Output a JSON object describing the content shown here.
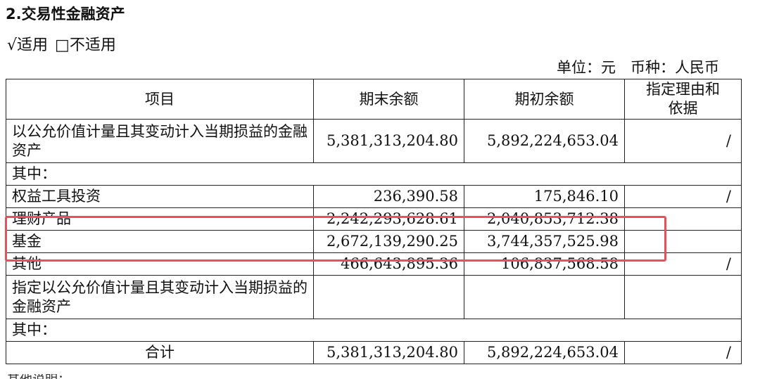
{
  "title": "2.交易性金融资产",
  "applicability": {
    "applicable": "√适用",
    "not_applicable": "□不适用"
  },
  "unit_line": "单位：元　币种：人民币",
  "table": {
    "headers": [
      "项目",
      "期末余额",
      "期初余额",
      "指定理由和依据"
    ],
    "rows": [
      {
        "item": "以公允价值计量且其变动计入当期损益的金融资产",
        "end": "5,381,313,204.80",
        "begin": "5,892,224,653.04",
        "reason": "/"
      },
      {
        "item": "其中：",
        "end": "",
        "begin": "",
        "reason": ""
      },
      {
        "item": "权益工具投资",
        "end": "236,390.58",
        "begin": "175,846.10",
        "reason": "/"
      },
      {
        "item": "理财产品",
        "end": "2,242,293,628.61",
        "begin": "2,040,853,712.38",
        "reason": ""
      },
      {
        "item": "基金",
        "end": "2,672,139,290.25",
        "begin": "3,744,357,525.98",
        "reason": ""
      },
      {
        "item": "其他",
        "end": "466,643,895.36",
        "begin": "106,837,568.58",
        "reason": "/"
      },
      {
        "item": "指定以公允价值计量且其变动计入当期损益的金融资产",
        "end": "",
        "begin": "",
        "reason": ""
      },
      {
        "item": "其中：",
        "end": "",
        "begin": "",
        "reason": ""
      },
      {
        "item": "合计",
        "end": "5,381,313,204.80",
        "begin": "5,892,224,653.04",
        "reason": "/"
      }
    ]
  },
  "footer_cut": "其他说明："
}
